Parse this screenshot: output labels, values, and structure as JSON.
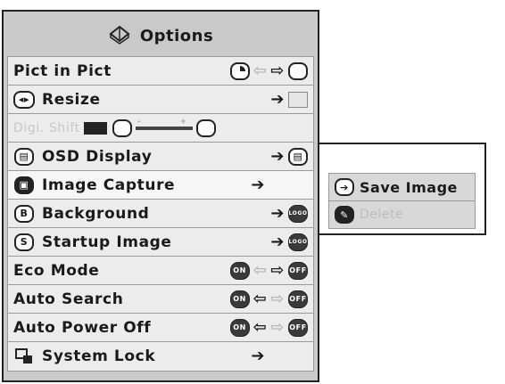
{
  "menu": {
    "title": "Options",
    "items": [
      {
        "label": "Pict in Pict",
        "disabled": false
      },
      {
        "label": "Resize",
        "disabled": false
      },
      {
        "label": "Digi. Shift",
        "disabled": true
      },
      {
        "label": "OSD Display",
        "disabled": false
      },
      {
        "label": "Image Capture",
        "disabled": false,
        "selected": true
      },
      {
        "label": "Background",
        "disabled": false,
        "badge": "LOGO"
      },
      {
        "label": "Startup Image",
        "disabled": false,
        "badge": "LOGO"
      },
      {
        "label": "Eco Mode",
        "on": "ON",
        "off": "OFF"
      },
      {
        "label": "Auto Search",
        "on": "ON",
        "off": "OFF"
      },
      {
        "label": "Auto Power Off",
        "on": "ON",
        "off": "OFF"
      },
      {
        "label": "System Lock",
        "disabled": false
      }
    ],
    "icons": {
      "title": "options-icon",
      "resize": "resize-icon",
      "osd": "osd-display-icon",
      "capture": "image-capture-icon",
      "background": "background-icon",
      "startup": "startup-image-icon",
      "lock": "system-lock-icon"
    },
    "background_letter": "B",
    "startup_letter": "S",
    "slider_minus": "-",
    "slider_plus": "+"
  },
  "submenu": {
    "items": [
      {
        "label": "Save Image",
        "disabled": false
      },
      {
        "label": "Delete",
        "disabled": true
      }
    ]
  },
  "colors": {
    "panel": "#c9c9c9",
    "row": "#ececec",
    "border": "#222222",
    "disabled_text": "#c8c8c8"
  }
}
